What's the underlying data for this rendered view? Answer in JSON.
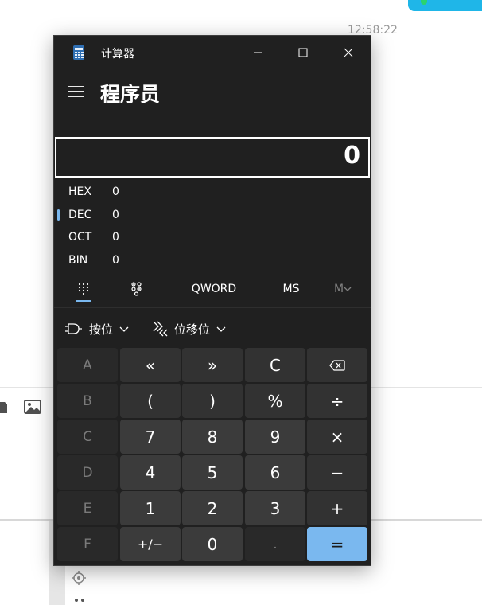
{
  "background": {
    "clock": "12:58:22"
  },
  "window": {
    "title": "计算器"
  },
  "mode": {
    "title": "程序员"
  },
  "display": {
    "value": "0"
  },
  "radix": [
    {
      "name": "HEX",
      "value": "0",
      "selected": false
    },
    {
      "name": "DEC",
      "value": "0",
      "selected": true
    },
    {
      "name": "OCT",
      "value": "0",
      "selected": false
    },
    {
      "name": "BIN",
      "value": "0",
      "selected": false
    }
  ],
  "toolbar": {
    "word_size": "QWORD",
    "memory_store": "MS",
    "memory_list": "M"
  },
  "bitops": {
    "bitwise_label": "按位",
    "bitshift_label": "位移位"
  },
  "keys": {
    "A": "A",
    "shift_left": "«",
    "shift_right": "»",
    "clear": "C",
    "B": "B",
    "lparen": "(",
    "rparen": ")",
    "mod": "%",
    "divide": "÷",
    "C": "C",
    "n7": "7",
    "n8": "8",
    "n9": "9",
    "multiply": "×",
    "D": "D",
    "n4": "4",
    "n5": "5",
    "n6": "6",
    "minus": "−",
    "E": "E",
    "n1": "1",
    "n2": "2",
    "n3": "3",
    "plus": "+",
    "F": "F",
    "negate": "+/−",
    "n0": "0",
    "decimal": ".",
    "equals": "="
  },
  "colors": {
    "accent": "#7ab8ef",
    "window_bg": "#202020",
    "key_number": "#3b3b3b",
    "key_operator": "#323232",
    "key_disabled": "#292929"
  }
}
